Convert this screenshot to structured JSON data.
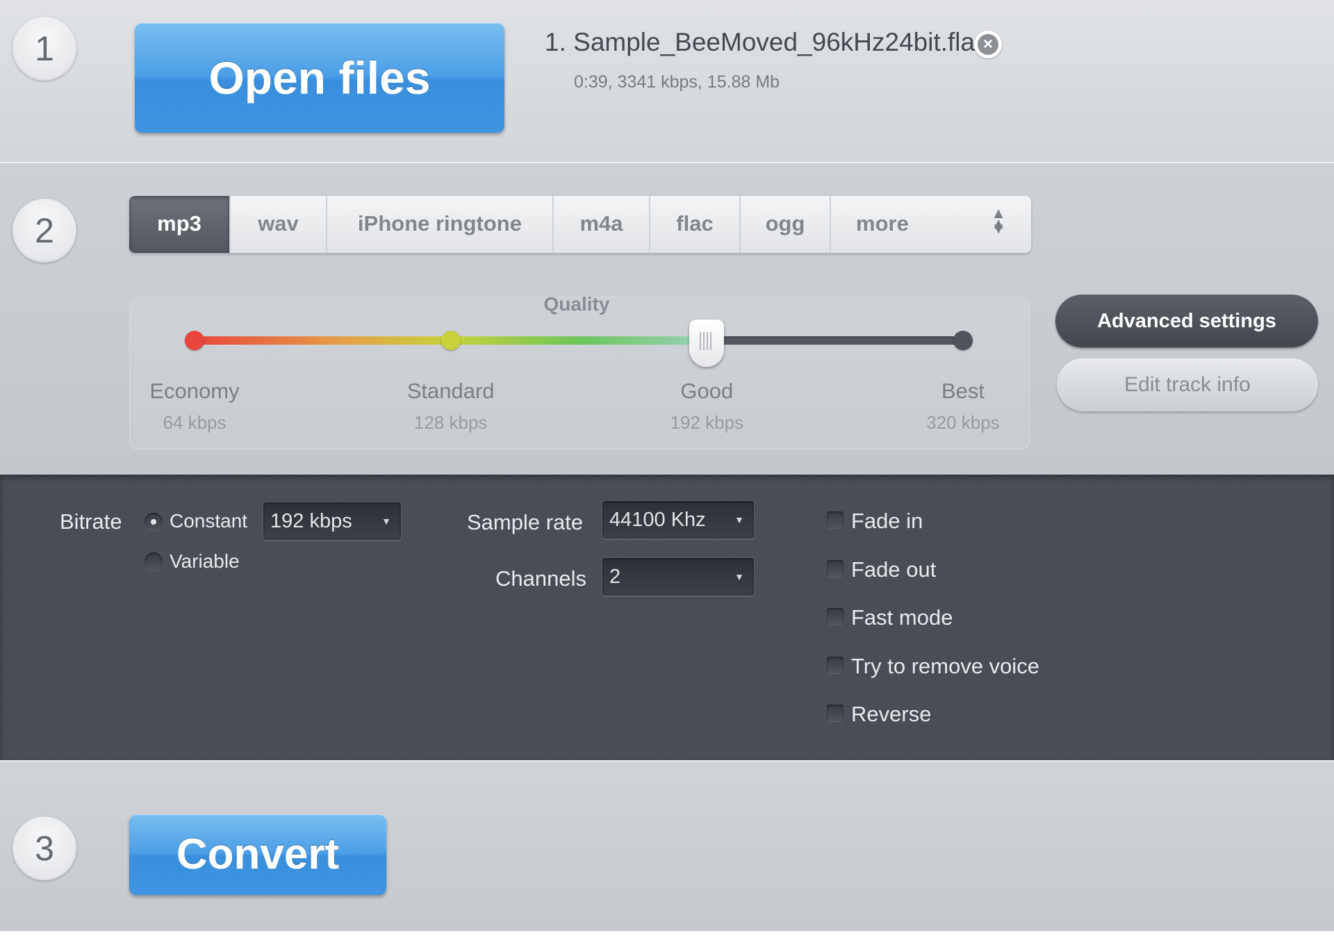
{
  "steps": [
    "1",
    "2",
    "3"
  ],
  "open_files": {
    "label": "Open files"
  },
  "file": {
    "name": "1. Sample_BeeMoved_96kHz24bit.flac",
    "meta": "0:39, 3341 kbps, 15.88 Mb",
    "remove_icon": "close-circle-icon"
  },
  "formats": {
    "tabs": [
      {
        "label": "mp3",
        "active": true
      },
      {
        "label": "wav",
        "active": false
      },
      {
        "label": "iPhone ringtone",
        "active": false
      },
      {
        "label": "m4a",
        "active": false
      },
      {
        "label": "flac",
        "active": false
      },
      {
        "label": "ogg",
        "active": false
      }
    ],
    "more_label": "more",
    "more_icon": "up-down-arrows-icon"
  },
  "quality": {
    "title": "Quality",
    "current_level": 2,
    "stops": [
      {
        "label": "Economy",
        "kbps": "64 kbps",
        "color": "#e8463c"
      },
      {
        "label": "Standard",
        "kbps": "128 kbps",
        "color": "#c7d23c"
      },
      {
        "label": "Good",
        "kbps": "192 kbps",
        "color": "#ffffff"
      },
      {
        "label": "Best",
        "kbps": "320 kbps",
        "color": "#505359"
      }
    ]
  },
  "actions": {
    "advanced_settings": "Advanced settings",
    "edit_track_info": "Edit track info"
  },
  "advanced": {
    "bitrate_label": "Bitrate",
    "bitrate_modes": [
      {
        "label": "Constant",
        "selected": true
      },
      {
        "label": "Variable",
        "selected": false
      }
    ],
    "bitrate_value": "192 kbps",
    "sample_rate_label": "Sample rate",
    "sample_rate_value": "44100 Khz",
    "channels_label": "Channels",
    "channels_value": "2",
    "options": [
      {
        "label": "Fade in",
        "checked": false
      },
      {
        "label": "Fade out",
        "checked": false
      },
      {
        "label": "Fast mode",
        "checked": false
      },
      {
        "label": "Try to remove voice",
        "checked": false
      },
      {
        "label": "Reverse",
        "checked": false
      }
    ]
  },
  "convert": {
    "label": "Convert"
  },
  "colors": {
    "accent_blue": "#4b9ee6",
    "panel_dark": "#494c54",
    "tab_active": "#5e636b"
  }
}
